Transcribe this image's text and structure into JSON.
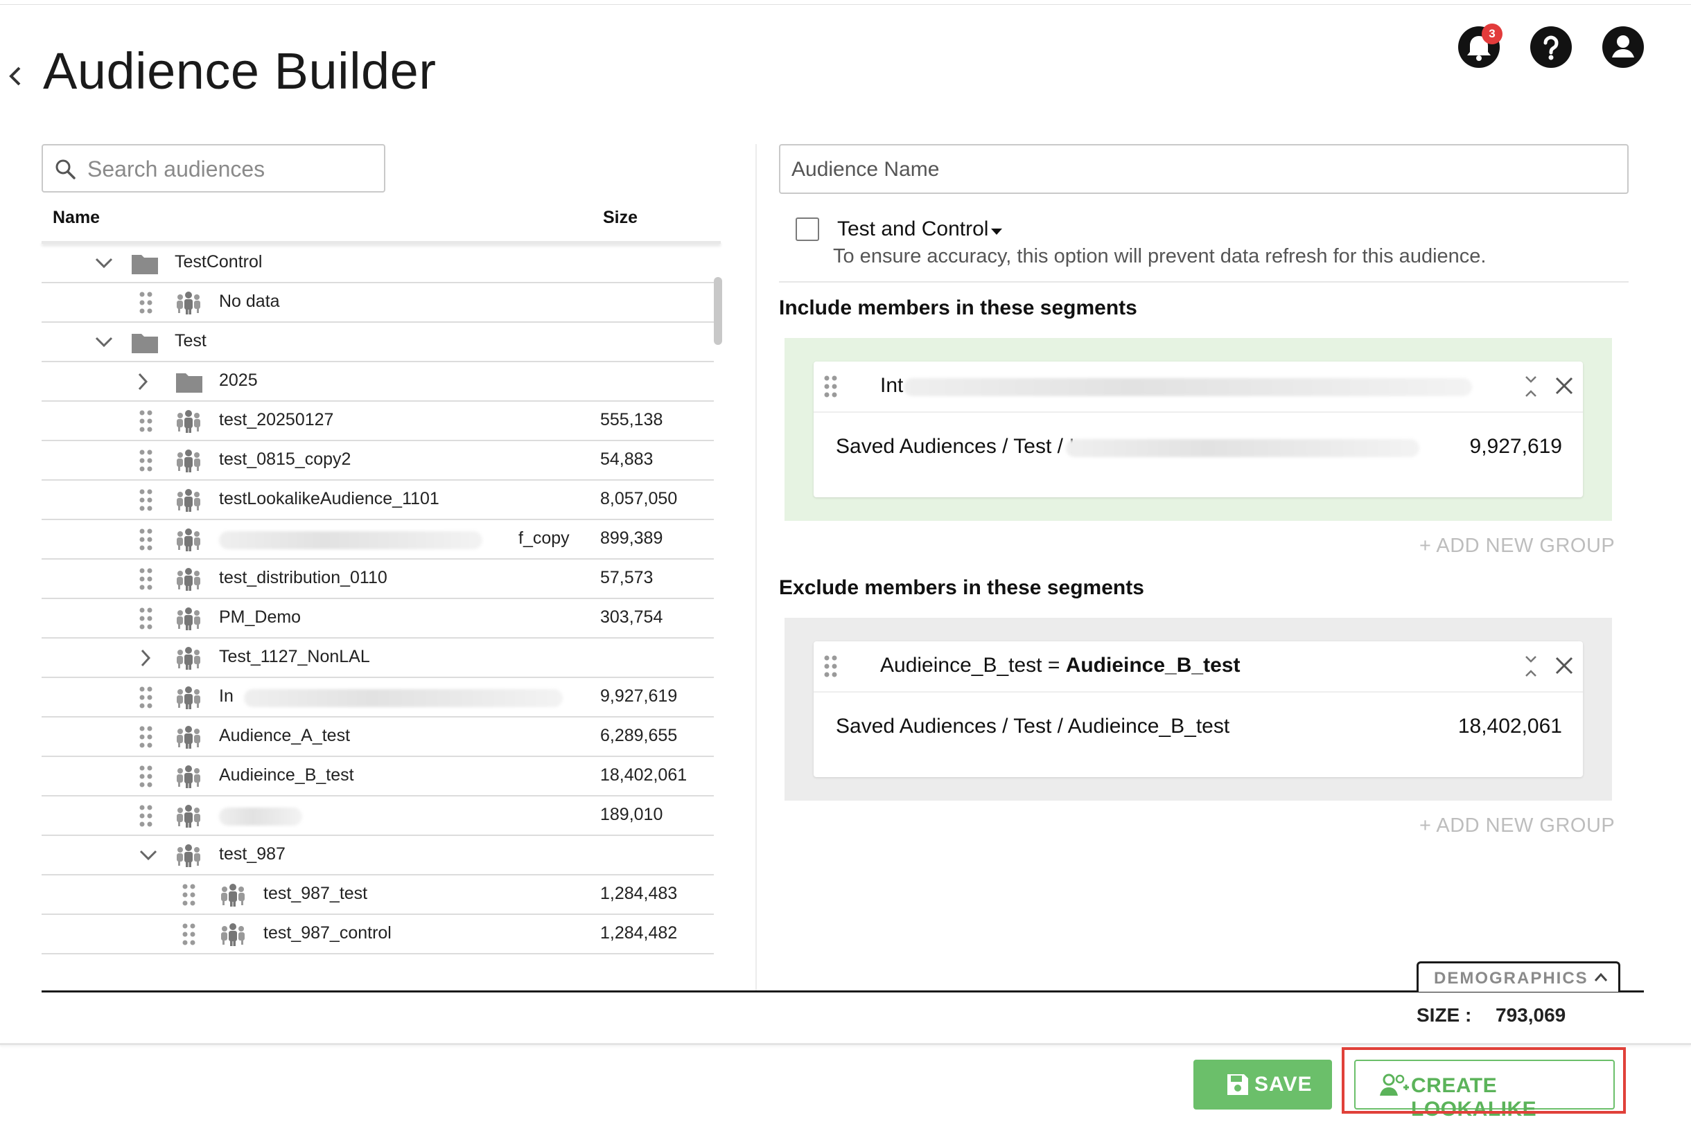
{
  "page": {
    "title": "Audience Builder",
    "notification_count": "3"
  },
  "search": {
    "placeholder": "Search audiences"
  },
  "table": {
    "name_header": "Name",
    "size_header": "Size",
    "rows": [
      {
        "label": "TestControl",
        "size": ""
      },
      {
        "label": "No data",
        "size": ""
      },
      {
        "label": "Test",
        "size": ""
      },
      {
        "label": "2025",
        "size": ""
      },
      {
        "label": "test_20250127",
        "size": "555,138"
      },
      {
        "label": "test_0815_copy2",
        "size": "54,883"
      },
      {
        "label": "testLookalikeAudience_1101",
        "size": "8,057,050"
      },
      {
        "label": "f_copy",
        "size": "899,389"
      },
      {
        "label": "test_distribution_0110",
        "size": "57,573"
      },
      {
        "label": "PM_Demo",
        "size": "303,754"
      },
      {
        "label": "Test_1127_NonLAL",
        "size": ""
      },
      {
        "label": "In",
        "size": "9,927,619"
      },
      {
        "label": "Audience_A_test",
        "size": "6,289,655"
      },
      {
        "label": "Audieince_B_test",
        "size": "18,402,061"
      },
      {
        "label": "",
        "size": "189,010"
      },
      {
        "label": "test_987",
        "size": ""
      },
      {
        "label": "test_987_test",
        "size": "1,284,483"
      },
      {
        "label": "test_987_control",
        "size": "1,284,482"
      }
    ]
  },
  "builder": {
    "audience_name_placeholder": "Audience Name",
    "test_control_label": "Test and Control",
    "test_control_note": "To ensure accuracy, this option will prevent data refresh for this audience.",
    "include_heading": "Include members in these segments",
    "include_card": {
      "title": "Int",
      "path": "Saved Audiences / Test / I",
      "size": "9,927,619"
    },
    "exclude_heading": "Exclude members in these segments",
    "exclude_card": {
      "title_prefix": "Audieince_B_test = ",
      "title_bold": "Audieince_B_test",
      "path": "Saved Audiences / Test / Audieince_B_test",
      "size": "18,402,061"
    },
    "add_group_label": "+ ADD NEW GROUP",
    "demographics_label": "DEMOGRAPHICS",
    "size_label": "SIZE :",
    "size_value": "793,069"
  },
  "footer": {
    "save_label": "SAVE",
    "lookalike_label": "CREATE LOOKALIKE"
  },
  "colors": {
    "accent_green": "#6bbf6a",
    "highlight_red": "#e0413a",
    "include_bg": "#e6f3e2",
    "exclude_bg": "#ececec"
  }
}
